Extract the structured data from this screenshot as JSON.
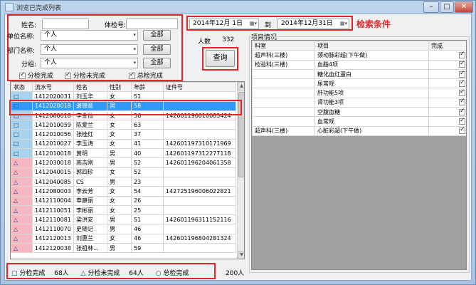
{
  "window": {
    "title": "浏览已完成列表",
    "minimize": "–",
    "maximize": "□",
    "close": "✕"
  },
  "search": {
    "name_label": "姓名:",
    "exam_no_label": "体检号:",
    "date_from": "2014年12月 1日",
    "date_to_label": "到",
    "date_to": "2014年12月31日",
    "annotation": "检索条件",
    "unit_label": "单位名称:",
    "unit_value": "个人",
    "dept_label": "部门名称:",
    "dept_value": "个人",
    "group_label": "分组:",
    "group_value": "个人",
    "all_button": "全部",
    "people_label": "人数",
    "people_count": "332",
    "query_button": "查询",
    "check_partial_done": "分检完成",
    "check_partial_undone": "分检未完成",
    "check_total_done": "总检完成"
  },
  "patients": {
    "columns": [
      "状态",
      "流水号",
      "姓名",
      "性别",
      "年龄",
      "证件号"
    ],
    "rows": [
      {
        "status": "□",
        "color": "blue",
        "serial": "1412020031",
        "name": "刘玉华",
        "sex": "女",
        "age": "51",
        "id": ""
      },
      {
        "status": "□",
        "color": "blue",
        "serial": "1412020018",
        "name": "邊锦意",
        "sex": "男",
        "age": "58",
        "id": ""
      },
      {
        "status": "□",
        "color": "blue",
        "serial": "1412080018",
        "name": "李金仙",
        "sex": "女",
        "age": "56",
        "id": "142601196010085424"
      },
      {
        "status": "□",
        "color": "blue",
        "serial": "1412010059",
        "name": "陈爱兰",
        "sex": "女",
        "age": "63",
        "id": ""
      },
      {
        "status": "□",
        "color": "blue",
        "serial": "1412010056",
        "name": "张桂红",
        "sex": "女",
        "age": "37",
        "id": ""
      },
      {
        "status": "□",
        "color": "blue",
        "serial": "1412010027",
        "name": "李玉涛",
        "sex": "女",
        "age": "41",
        "id": "142601197310171969"
      },
      {
        "status": "□",
        "color": "blue",
        "serial": "1412010018",
        "name": "黄明",
        "sex": "男",
        "age": "40",
        "id": "142601197312277118"
      },
      {
        "status": "△",
        "color": "pink",
        "serial": "1412030018",
        "name": "燕吉刚",
        "sex": "男",
        "age": "52",
        "id": "142601196204061358"
      },
      {
        "status": "△",
        "color": "pink",
        "serial": "1412040015",
        "name": "郭四珍",
        "sex": "女",
        "age": "52",
        "id": ""
      },
      {
        "status": "△",
        "color": "pink",
        "serial": "1412040085",
        "name": "CS",
        "sex": "男",
        "age": "23",
        "id": ""
      },
      {
        "status": "△",
        "color": "pink",
        "serial": "1412080003",
        "name": "李云芳",
        "sex": "女",
        "age": "54",
        "id": "142725196006022821"
      },
      {
        "status": "△",
        "color": "pink",
        "serial": "1412110004",
        "name": "申康丽",
        "sex": "女",
        "age": "26",
        "id": ""
      },
      {
        "status": "△",
        "color": "pink",
        "serial": "1412110051",
        "name": "李彬丽",
        "sex": "女",
        "age": "25",
        "id": ""
      },
      {
        "status": "△",
        "color": "pink",
        "serial": "1412110081",
        "name": "梁洪安",
        "sex": "男",
        "age": "51",
        "id": "142601196311152116"
      },
      {
        "status": "△",
        "color": "pink",
        "serial": "1412110070",
        "name": "史随记",
        "sex": "男",
        "age": "46",
        "id": ""
      },
      {
        "status": "△",
        "color": "pink",
        "serial": "1412120013",
        "name": "刘惠兰",
        "sex": "女",
        "age": "46",
        "id": "142601196804281324"
      },
      {
        "status": "△",
        "color": "pink",
        "serial": "1412120038",
        "name": "张祖林...",
        "sex": "男",
        "age": "59",
        "id": ""
      }
    ]
  },
  "legend": {
    "partial_done_symbol": "□",
    "partial_done_label": "分检完成",
    "partial_done_count": "68人",
    "partial_undone_symbol": "△",
    "partial_undone_label": "分检未完成",
    "partial_undone_count": "64人",
    "total_done_symbol": "○",
    "total_done_label": "总检完成",
    "total_count": "200人"
  },
  "items": {
    "group_title": "项目情况",
    "columns": [
      "科室",
      "项目",
      "完成"
    ],
    "rows": [
      {
        "dept": "超声科(三楼)",
        "item": "颈动脉彩超(下午做)",
        "done": true
      },
      {
        "dept": "检验科(三楼)",
        "item": "血脂4项",
        "done": true
      },
      {
        "dept": "",
        "item": "糖化血红蛋白",
        "done": true
      },
      {
        "dept": "",
        "item": "尿常规",
        "done": true
      },
      {
        "dept": "",
        "item": "肝功能5项",
        "done": true
      },
      {
        "dept": "",
        "item": "肾功能3项",
        "done": true
      },
      {
        "dept": "",
        "item": "空腹血糖",
        "done": true
      },
      {
        "dept": "",
        "item": "血常规",
        "done": true
      },
      {
        "dept": "超声科(三楼)",
        "item": "心脏彩超(下午做)",
        "done": true
      }
    ]
  },
  "colors": {
    "selected": "#3399ff",
    "status_done": "#a9d2ec",
    "status_undone": "#f6b7bf",
    "annotation": "#e3262a"
  }
}
